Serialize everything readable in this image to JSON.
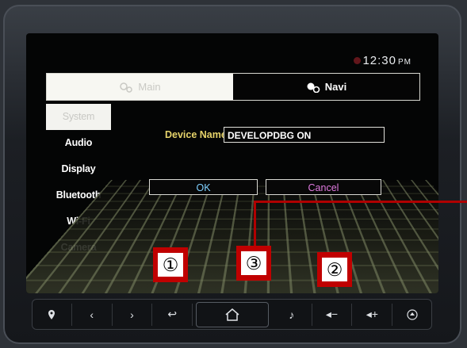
{
  "status": {
    "time": "12:30",
    "ampm": "PM"
  },
  "tabs": [
    {
      "label": "Main",
      "icon": "main-settings-icon",
      "selected": false
    },
    {
      "label": "Navi",
      "icon": "navi-settings-icon",
      "selected": true
    }
  ],
  "sidebar": {
    "items": [
      {
        "label": "System",
        "active": true
      },
      {
        "label": "Audio"
      },
      {
        "label": "Display"
      },
      {
        "label": "Bluetooth"
      },
      {
        "label": "Wi-Fi"
      },
      {
        "label": "Camera"
      }
    ]
  },
  "content": {
    "device_name_label": "Device Name",
    "device_name_value": "DEVELOPDBG ON",
    "ok_label": "OK",
    "cancel_label": "Cancel"
  },
  "annotations": {
    "one": "①",
    "two": "②",
    "three": "③"
  },
  "hardware_buttons": [
    "location-icon",
    "prev-icon",
    "next-icon",
    "back-icon",
    "home-icon",
    "media-power-icon",
    "volume-down-icon",
    "volume-up-icon",
    "eject-icon"
  ],
  "colors": {
    "label_yellow": "#e6d36a",
    "ok_cyan": "#7fd0ff",
    "cancel_magenta": "#e07adf",
    "callout_red": "#c00000"
  }
}
